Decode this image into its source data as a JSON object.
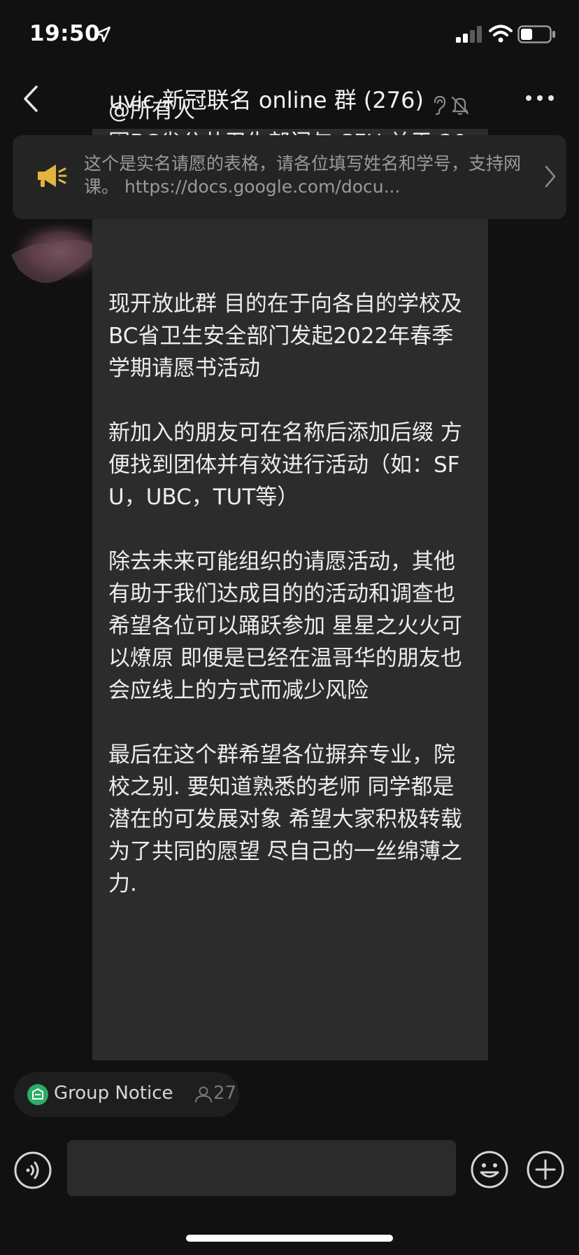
{
  "status_bar": {
    "time": "19:50"
  },
  "header": {
    "title": "uvic 新冠联名 online 群 (276)",
    "icons": [
      "back-icon",
      "ear-icon",
      "mute-bell-icon",
      "more-icon"
    ]
  },
  "pinned": {
    "text": "这个是实名请愿的表格，请各位填写姓名和学号，支持网课。 https://docs.google.com/docu..."
  },
  "message": {
    "text": "@所有人\n因BC省公共卫生部门与 SFU 关于 2022年春季学期防疫政策的决定 引起许多留学生及普通人群的不满\n\n\n现开放此群 目的在于向各自的学校及BC省卫生安全部门发起2022年春季学期请愿书活动\n\n新加入的朋友可在名称后添加后缀 方便找到团体并有效进行活动（如：SFU，UBC，TUT等）\n\n除去未来可能组织的请愿活动，其他有助于我们达成目的的活动和调查也希望各位可以踊跃参加 星星之火火可以燎原 即便是已经在温哥华的朋友也会应线上的方式而减少风险\n\n最后在这个群希望各位摒弃专业，院校之别. 要知道熟悉的老师 同学都是潜在的可发展对象 希望大家积极转载 为了共同的愿望 尽自己的一丝绵薄之力."
  },
  "notice": {
    "label": "Group Notice",
    "count": "27"
  },
  "input": {
    "value": "",
    "placeholder": ""
  },
  "colors": {
    "background": "#111111",
    "bubble": "#2c2c2c",
    "banner": "#242424",
    "notice_icon": "#2aae67"
  }
}
